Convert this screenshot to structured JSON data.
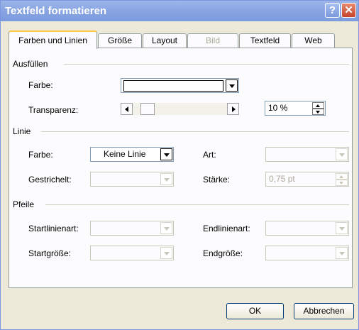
{
  "window": {
    "title": "Textfeld formatieren",
    "help_glyph": "?",
    "close_glyph": "✕"
  },
  "tabs": [
    {
      "label": "Farben und Linien",
      "active": true
    },
    {
      "label": "Größe"
    },
    {
      "label": "Layout"
    },
    {
      "label": "Bild",
      "disabled": true
    },
    {
      "label": "Textfeld"
    },
    {
      "label": "Web"
    }
  ],
  "fill": {
    "section": "Ausfüllen",
    "color_label": "Farbe:",
    "color_value": "",
    "transparency_label": "Transparenz:",
    "transparency_value": "10 %",
    "transparency_level": 0.1
  },
  "line": {
    "section": "Linie",
    "color_label": "Farbe:",
    "color_value": "Keine Linie",
    "style_label": "Art:",
    "dash_label": "Gestrichelt:",
    "weight_label": "Stärke:",
    "weight_value": "0,75 pt"
  },
  "arrows": {
    "section": "Pfeile",
    "begin_style_label": "Startlinienart:",
    "end_style_label": "Endlinienart:",
    "begin_size_label": "Startgröße:",
    "end_size_label": "Endgröße:"
  },
  "buttons": {
    "ok": "OK",
    "cancel": "Abbrechen"
  },
  "colors": {
    "titlebar": "#8aa6e2",
    "dialog": "#ece9d8",
    "tab_highlight": "#ffc83c"
  }
}
